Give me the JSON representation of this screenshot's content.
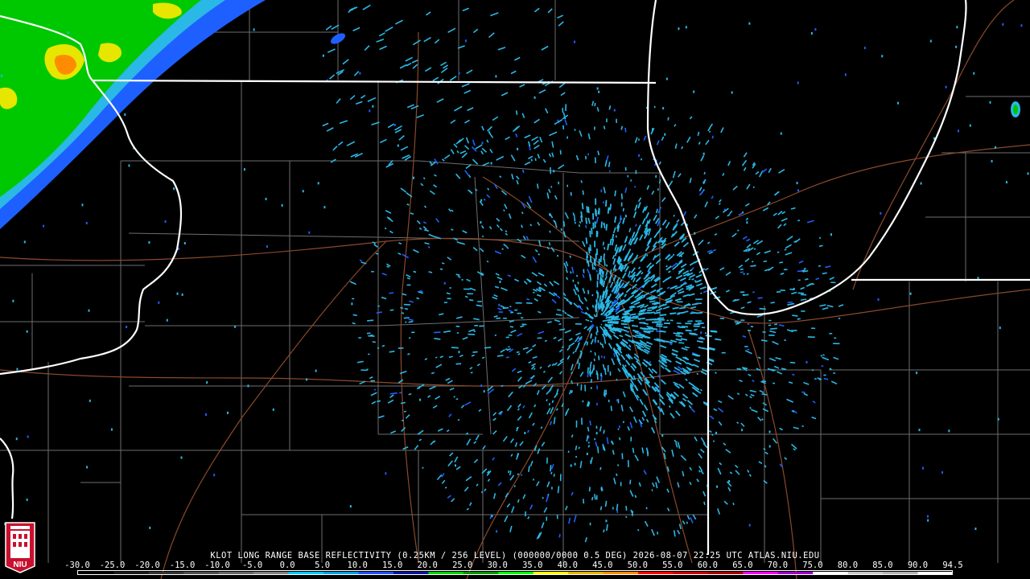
{
  "product_title": "KLOT LONG RANGE BASE REFLECTIVITY (0.25KM / 256 LEVEL) (000000/0000 0.5 DEG) 2026-08-07 22:25 UTC  ATLAS.NIU.EDU",
  "scale_labels": [
    "-30.0",
    "-25.0",
    "-20.0",
    "-15.0",
    "-10.0",
    "-5.0",
    "0.0",
    "5.0",
    "10.0",
    "15.0",
    "20.0",
    "25.0",
    "30.0",
    "35.0",
    "40.0",
    "45.0",
    "50.0",
    "55.0",
    "60.0",
    "65.0",
    "70.0",
    "75.0",
    "80.0",
    "85.0",
    "90.0",
    "94.5"
  ],
  "scale_colors": [
    "#000000",
    "#1a1a1a",
    "#333333",
    "#4d4d4d",
    "#666666",
    "#808080",
    "#00c8ff",
    "#00a0e6",
    "#1e50ff",
    "#0a14a0",
    "#00d200",
    "#009600",
    "#00ff00",
    "#ffff00",
    "#e6b400",
    "#ff8c00",
    "#ff0000",
    "#c80000",
    "#a00000",
    "#ff00ff",
    "#a000c8",
    "#ffffff",
    "#c8c8c8",
    "#b4b4b4",
    "#ffffff"
  ],
  "logo_text": "NIU",
  "colors": {
    "background": "#000000",
    "state_border": "#ffffff",
    "county_border": "#6e6e6e",
    "highway": "#8b4a2b",
    "light_echo": "#2ab8e6",
    "mid_echo": "#1e60ff",
    "green_echo": "#00c800",
    "yellow_echo": "#e6e600",
    "orange_echo": "#ff8c00"
  }
}
